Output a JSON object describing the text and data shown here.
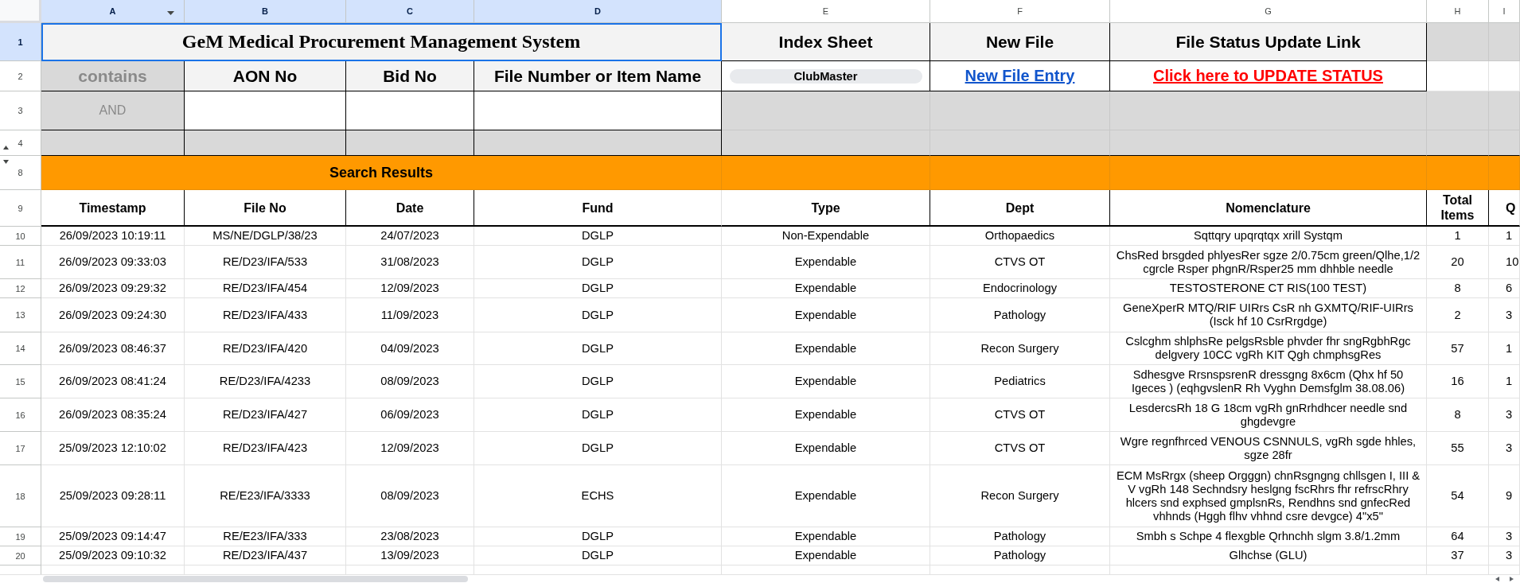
{
  "columns": [
    {
      "label": "A",
      "selected": true,
      "menu": true
    },
    {
      "label": "B",
      "selected": true
    },
    {
      "label": "C",
      "selected": true
    },
    {
      "label": "D",
      "selected": true
    },
    {
      "label": "E",
      "selected": false
    },
    {
      "label": "F",
      "selected": false
    },
    {
      "label": "G",
      "selected": false
    },
    {
      "label": "H",
      "selected": false
    },
    {
      "label": "I",
      "selected": false
    }
  ],
  "title_row": {
    "number": "1",
    "selected": true,
    "title": "GeM Medical Procurement Management System",
    "headings": [
      "Index Sheet",
      "New File",
      "File Status Update Link"
    ]
  },
  "search_row": {
    "number": "2",
    "selected": false,
    "operator": "contains",
    "labels": [
      "AON No",
      "Bid No",
      "File Number or Item Name"
    ],
    "chip": "ClubMaster",
    "links": [
      {
        "text": "New File Entry",
        "kind": "primary"
      },
      {
        "text": "Click here to UPDATE STATUS",
        "kind": "alert"
      }
    ]
  },
  "input_row": {
    "number": "3",
    "selected": false,
    "operator": "AND"
  },
  "spacer_row": {
    "number": "4",
    "selected": false,
    "hidden_rows_below": true
  },
  "banner_row": {
    "number": "8",
    "selected": false,
    "title": "Search Results"
  },
  "table": {
    "number": "9",
    "selected": false,
    "columns": [
      "Timestamp",
      "File No",
      "Date",
      "Fund",
      "Type",
      "Dept",
      "Nomenclature",
      "Total Items",
      "Q"
    ],
    "rows": [
      {
        "number": "10",
        "selected": false,
        "cells": [
          "26/09/2023 10:19:11",
          "MS/NE/DGLP/38/23",
          "24/07/2023",
          "DGLP",
          "Non-Expendable",
          "Orthopaedics",
          "Sqttqry upqrqtqx xrill Systqm",
          "1",
          "1"
        ]
      },
      {
        "number": "11",
        "selected": false,
        "cells": [
          "26/09/2023 09:33:03",
          "RE/D23/IFA/533",
          "31/08/2023",
          "DGLP",
          "Expendable",
          "CTVS OT",
          "ChsRed brsgded phlyesRer sgze 2/0.75cm green/Qlhe,1/2\ncgrcle Rsper phgnR/Rsper25 mm dhhble needle",
          "20",
          "10"
        ]
      },
      {
        "number": "12",
        "selected": false,
        "cells": [
          "26/09/2023 09:29:32",
          "RE/D23/IFA/454",
          "12/09/2023",
          "DGLP",
          "Expendable",
          "Endocrinology",
          "TESTOSTERONE CT RIS(100 TEST)",
          "8",
          "6"
        ]
      },
      {
        "number": "13",
        "selected": false,
        "cells": [
          "26/09/2023 09:24:30",
          "RE/D23/IFA/433",
          "11/09/2023",
          "DGLP",
          "Expendable",
          "Pathology",
          "GeneXperR MTQ/RIF UIRrs CsR nh GXMTQ/RIF-UIRrs\n(Isck hf 10 CsrRrgdge)",
          "2",
          "3"
        ]
      },
      {
        "number": "14",
        "selected": false,
        "cells": [
          "26/09/2023 08:46:37",
          "RE/D23/IFA/420",
          "04/09/2023",
          "DGLP",
          "Expendable",
          "Recon Surgery",
          "Cslcghm shlphsRe pelgsRsble phvder fhr sngRgbhRgc\ndelgvery 10CC vgRh KIT Qgh chmphsgRes",
          "57",
          "1"
        ]
      },
      {
        "number": "15",
        "selected": false,
        "cells": [
          "26/09/2023 08:41:24",
          "RE/D23/IFA/4233",
          "08/09/2023",
          "DGLP",
          "Expendable",
          "Pediatrics",
          "Sdhesgve RrsnspsrenR dressgng 8x6cm (Qhx hf 50\nIgeces ) (eqhgvslenR Rh Vyghn Demsfglm 38.08.06)",
          "16",
          "1"
        ]
      },
      {
        "number": "16",
        "selected": false,
        "cells": [
          "26/09/2023 08:35:24",
          "RE/D23/IFA/427",
          "06/09/2023",
          "DGLP",
          "Expendable",
          "CTVS OT",
          "LesdercsRh 18 G 18cm vgRh gnRrhdhcer needle snd\nghgdevgre",
          "8",
          "3"
        ]
      },
      {
        "number": "17",
        "selected": false,
        "cells": [
          "25/09/2023 12:10:02",
          "RE/D23/IFA/423",
          "12/09/2023",
          "DGLP",
          "Expendable",
          "CTVS OT",
          "Wgre regnfhrced VENOUS CSNNULS, vgRh sgde hhles,\nsgze 28fr",
          "55",
          "3"
        ]
      },
      {
        "number": "18",
        "selected": false,
        "cells": [
          "25/09/2023 09:28:11",
          "RE/E23/IFA/3333",
          "08/09/2023",
          "ECHS",
          "Expendable",
          "Recon Surgery",
          "ECM MsRrgx (sheep Orgggn) chnRsgngng chllsgen I, III &\nV vgRh 148 Sechndsry heslgng fscRhrs fhr refrscRhry\nhlcers snd exphsed gmplsnRs, Rendhns snd gnfecRed\nvhhnds (Hggh flhv vhhnd csre devgce) 4\"x5\"",
          "54",
          "9"
        ]
      },
      {
        "number": "19",
        "selected": false,
        "cells": [
          "25/09/2023 09:14:47",
          "RE/E23/IFA/333",
          "23/08/2023",
          "DGLP",
          "Expendable",
          "Pathology",
          "Smbh s Schpe 4 flexgble Qrhnchh slgm 3.8/1.2mm",
          "64",
          "3"
        ]
      },
      {
        "number": "20",
        "selected": false,
        "cells": [
          "25/09/2023 09:10:32",
          "RE/D23/IFA/437",
          "13/09/2023",
          "DGLP",
          "Expendable",
          "Pathology",
          "Glhchse (GLU)",
          "37",
          "3"
        ]
      }
    ]
  }
}
